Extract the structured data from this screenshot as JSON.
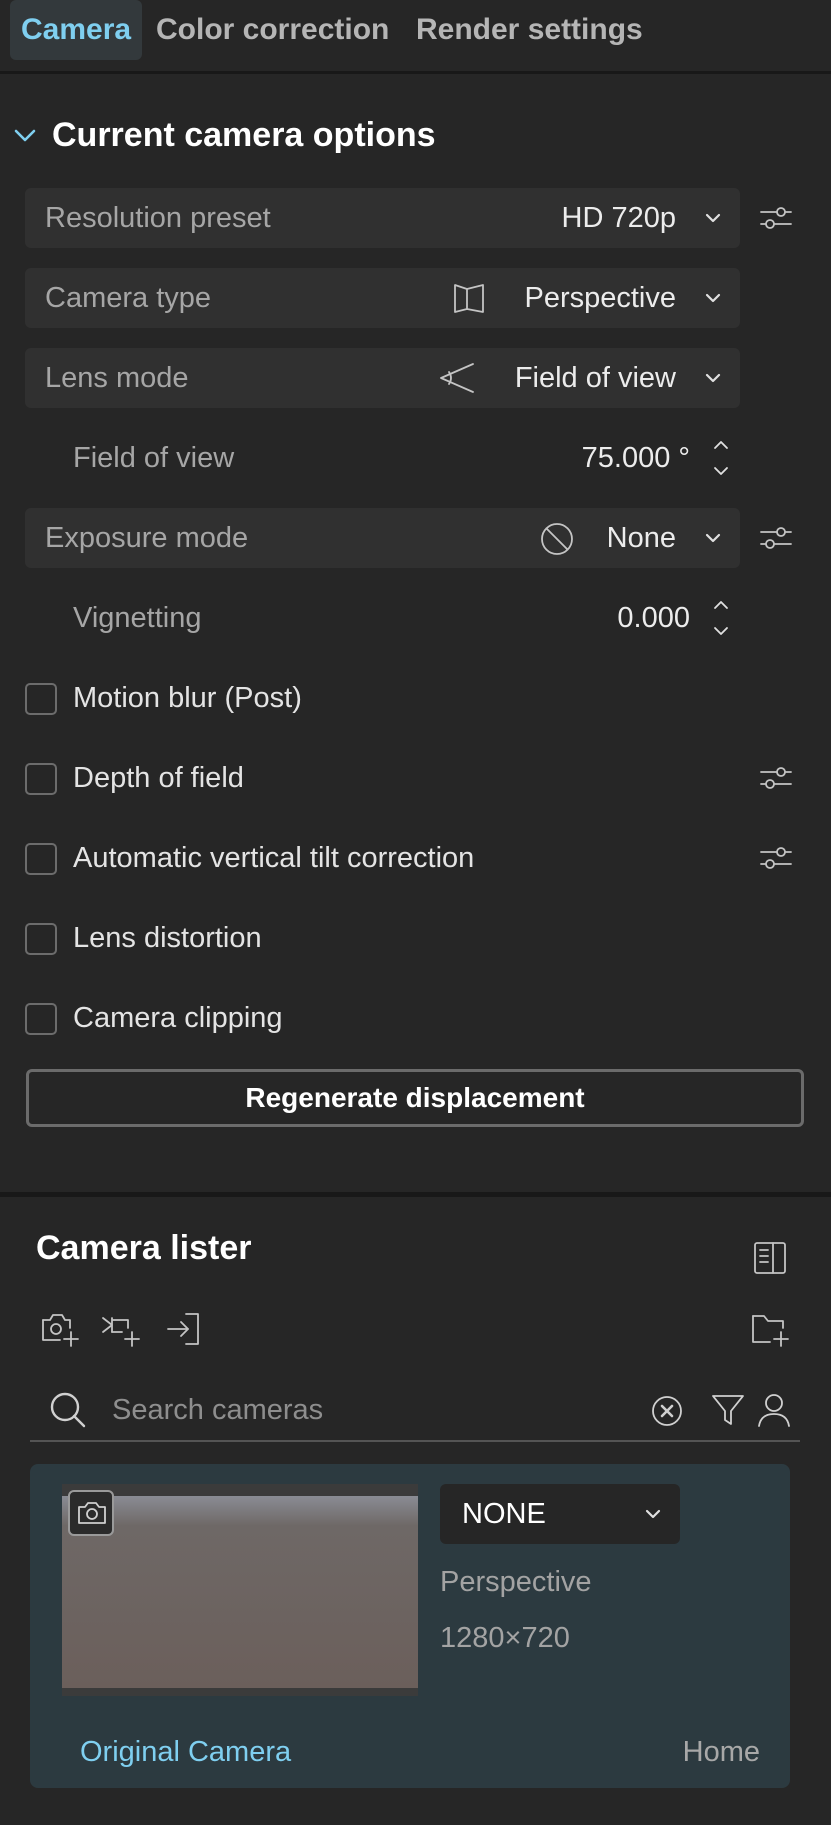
{
  "tabs": [
    {
      "label": "Camera",
      "active": true
    },
    {
      "label": "Color correction",
      "active": false
    },
    {
      "label": "Render settings",
      "active": false
    }
  ],
  "section": {
    "title": "Current camera options",
    "expanded": true
  },
  "rows": {
    "resolution": {
      "label": "Resolution preset",
      "value": "HD 720p"
    },
    "camera_type": {
      "label": "Camera type",
      "value": "Perspective",
      "icon": "perspective-icon"
    },
    "lens_mode": {
      "label": "Lens mode",
      "value": "Field of view",
      "icon": "field-of-view-icon"
    },
    "fov": {
      "label": "Field of view",
      "value": "75.000 °"
    },
    "exposure": {
      "label": "Exposure mode",
      "value": "None",
      "icon": "none-icon"
    },
    "vignetting": {
      "label": "Vignetting",
      "value": "0.000"
    }
  },
  "checkboxes": [
    {
      "label": "Motion blur (Post)",
      "checked": false
    },
    {
      "label": "Depth of field",
      "checked": false
    },
    {
      "label": "Automatic vertical tilt correction",
      "checked": false
    },
    {
      "label": "Lens distortion",
      "checked": false
    },
    {
      "label": "Camera clipping",
      "checked": false
    }
  ],
  "regen_label": "Regenerate displacement",
  "lister": {
    "title": "Camera lister",
    "search_placeholder": "Search cameras",
    "card": {
      "dropdown_value": "NONE",
      "type": "Perspective",
      "resolution": "1280×720",
      "name": "Original Camera",
      "location": "Home"
    }
  },
  "colors": {
    "background": "#262626",
    "accent": "#7fcff0",
    "row_bg": "#303030",
    "card_bg": "#2c3a40"
  }
}
